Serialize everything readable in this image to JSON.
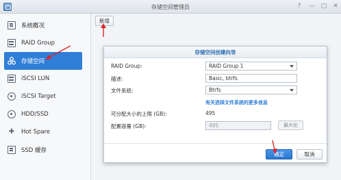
{
  "window": {
    "title": "存储空间管理员",
    "controls": {
      "help": "?",
      "minimize": "—",
      "maximize": "□",
      "close": "✕"
    }
  },
  "sidebar": {
    "items": [
      {
        "label": "系统概况",
        "icon": "overview-icon",
        "active": false
      },
      {
        "label": "RAID Group",
        "icon": "raid-group-icon",
        "active": false
      },
      {
        "label": "存储空间",
        "icon": "volume-icon",
        "active": true
      },
      {
        "label": "iSCSI LUN",
        "icon": "iscsi-lun-icon",
        "active": false
      },
      {
        "label": "iSCSI Target",
        "icon": "iscsi-target-icon",
        "active": false
      },
      {
        "label": "HDD/SSD",
        "icon": "hdd-icon",
        "active": false
      },
      {
        "label": "Hot Spare",
        "icon": "hot-spare-icon",
        "active": false
      },
      {
        "label": "SSD 缓存",
        "icon": "ssd-cache-icon",
        "active": false
      }
    ]
  },
  "toolbar": {
    "new_label": "新增"
  },
  "dialog": {
    "title": "存储空间创建向导",
    "raid_group": {
      "label": "RAID Group:",
      "value": "RAID Group 1"
    },
    "description": {
      "label": "描述:",
      "value": "Basic, btrfs"
    },
    "filesystem": {
      "label": "文件系统:",
      "value": "Btrfs"
    },
    "filesystem_info_link": "有关选择文件系统的更多信息",
    "max_capacity": {
      "label": "可分配大小的上限 (GB):",
      "value": "495"
    },
    "allocated_size": {
      "label": "配置容量 (GB):",
      "value": "495",
      "max_button": "最大化"
    },
    "ok_label": "确定",
    "cancel_label": "取消"
  },
  "annotations": {
    "arrow_color": "#d9262c"
  },
  "colors": {
    "accent": "#2f7ed8",
    "dialog_title": "#2f6fb3"
  }
}
